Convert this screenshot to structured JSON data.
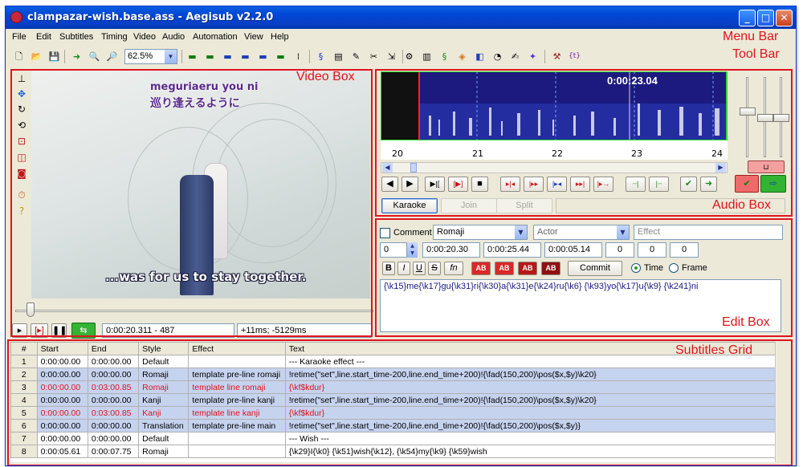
{
  "window": {
    "title": "clampazar-wish.base.ass - Aegisub v2.2.0"
  },
  "menu": [
    "File",
    "Edit",
    "Subtitles",
    "Timing",
    "Video",
    "Audio",
    "Automation",
    "View",
    "Help"
  ],
  "toolbar": {
    "zoom": "62.5%"
  },
  "annotations": {
    "menu_bar": "Menu Bar",
    "tool_bar": "Tool Bar",
    "video_box": "Video Box",
    "audio_box": "Audio Box",
    "edit_box": "Edit Box",
    "subtitles_grid": "Subtitles Grid"
  },
  "video": {
    "caption_top_romaji": "meguriaeru you ni",
    "caption_top_kanji": "巡り逢えるように",
    "caption_bottom": "...was for us to stay together.",
    "time_display": "0:00:20.311 - 487",
    "offset_display": "+11ms; -5129ms"
  },
  "audio": {
    "time_overlay": "0:00:23.04",
    "ticks": [
      "20",
      "21",
      "22",
      "23",
      "24"
    ],
    "mode_karaoke": "Karaoke",
    "mode_join": "Join",
    "mode_split": "Split"
  },
  "edit": {
    "comment_label": "Comment",
    "style_value": "Romaji",
    "actor_value": "Actor",
    "effect_placeholder": "Effect",
    "layer": "0",
    "start": "0:00:20.30",
    "end": "0:00:25.44",
    "duration": "0:00:05.14",
    "margin_l": "0",
    "margin_r": "0",
    "margin_v": "0",
    "fmt_bold": "B",
    "fmt_italic": "I",
    "fmt_underline": "U",
    "fmt_strike": "S",
    "fmt_fn": "fn",
    "color_ab": "AB",
    "commit": "Commit",
    "radio_time": "Time",
    "radio_frame": "Frame",
    "text": "{\\k15}me{\\k17}gu{\\k31}ri{\\k30}a{\\k31}e{\\k24}ru{\\k6} {\\k93}yo{\\k17}u{\\k9} {\\k241}ni"
  },
  "grid": {
    "headers": [
      "#",
      "Start",
      "End",
      "Style",
      "Effect",
      "Text"
    ],
    "rows": [
      {
        "n": "1",
        "start": "0:00:00.00",
        "end": "0:00:00.00",
        "style": "Default",
        "effect": "",
        "text": "--- Karaoke effect ---",
        "comment": false
      },
      {
        "n": "2",
        "start": "0:00:00.00",
        "end": "0:00:00.00",
        "style": "Romaji",
        "effect": "template pre-line romaji",
        "text": "!retime(\"set\",line.start_time-200,line.end_time+200)!{\\fad(150,200)\\pos($x,$y)\\k20}",
        "comment": false
      },
      {
        "n": "3",
        "start": "0:00:00.00",
        "end": "0:03:00.85",
        "style": "Romaji",
        "effect": "template line romaji",
        "text": "{\\kf$kdur}",
        "comment": true
      },
      {
        "n": "4",
        "start": "0:00:00.00",
        "end": "0:00:00.00",
        "style": "Kanji",
        "effect": "template pre-line kanji",
        "text": "!retime(\"set\",line.start_time-200,line.end_time+200)!{\\fad(150,200)\\pos($x,$y)\\k20}",
        "comment": false
      },
      {
        "n": "5",
        "start": "0:00:00.00",
        "end": "0:03:00.85",
        "style": "Kanji",
        "effect": "template line kanji",
        "text": "{\\kf$kdur}",
        "comment": true
      },
      {
        "n": "6",
        "start": "0:00:00.00",
        "end": "0:00:00.00",
        "style": "Translation",
        "effect": "template pre-line main",
        "text": "!retime(\"set\",line.start_time-200,line.end_time+200)!{\\fad(150,200)\\pos($x,$y)}",
        "comment": false
      },
      {
        "n": "7",
        "start": "0:00:00.00",
        "end": "0:00:00.00",
        "style": "Default",
        "effect": "",
        "text": "--- Wish ---",
        "comment": false
      },
      {
        "n": "8",
        "start": "0:00:05.61",
        "end": "0:00:07.75",
        "style": "Romaji",
        "effect": "",
        "text": "{\\k29}I{\\k0} {\\k51}wish{\\k12}, {\\k54}my{\\k9} {\\k59}wish",
        "comment": false
      }
    ]
  },
  "colors": {
    "annotation": "#e0141e",
    "selected_row": "#c6d3ef",
    "comment_row": "#e0141e"
  }
}
